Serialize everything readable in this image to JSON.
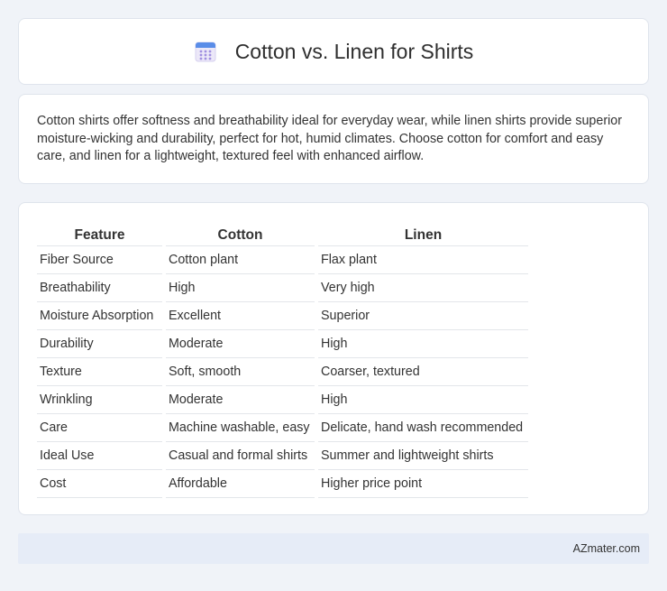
{
  "header": {
    "icon": "calendar-icon",
    "title": "Cotton vs. Linen for Shirts"
  },
  "summary": {
    "text": "Cotton shirts offer softness and breathability ideal for everyday wear, while linen shirts provide superior moisture-wicking and durability, perfect for hot, humid climates. Choose cotton for comfort and easy care, and linen for a lightweight, textured feel with enhanced airflow."
  },
  "table": {
    "headers": [
      "Feature",
      "Cotton",
      "Linen"
    ],
    "rows": [
      [
        "Fiber Source",
        "Cotton plant",
        "Flax plant"
      ],
      [
        "Breathability",
        "High",
        "Very high"
      ],
      [
        "Moisture Absorption",
        "Excellent",
        "Superior"
      ],
      [
        "Durability",
        "Moderate",
        "High"
      ],
      [
        "Texture",
        "Soft, smooth",
        "Coarser, textured"
      ],
      [
        "Wrinkling",
        "Moderate",
        "High"
      ],
      [
        "Care",
        "Machine washable, easy",
        "Delicate, hand wash recommended"
      ],
      [
        "Ideal Use",
        "Casual and formal shirts",
        "Summer and lightweight shirts"
      ],
      [
        "Cost",
        "Affordable",
        "Higher price point"
      ]
    ]
  },
  "footer": {
    "brand": "AZmater.com"
  },
  "colors": {
    "background": "#f0f3f8",
    "card": "#ffffff",
    "footer_bg": "#e6ecf7",
    "icon_top": "#5a8de8",
    "icon_body": "#e8e4f7",
    "icon_dots": "#a08fe0"
  }
}
